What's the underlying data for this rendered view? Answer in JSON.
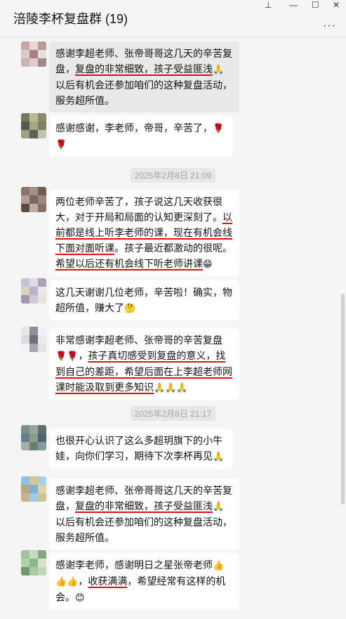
{
  "window": {
    "title": "涪陵李杯复盘群 (19)",
    "controls": {
      "pin": "⊥",
      "minimize": "—",
      "maximize": "☐",
      "close": "✕"
    },
    "more": "···"
  },
  "messages": [
    {
      "parts": [
        "感谢李超老师、张帝哥哥这几天的辛苦复盘，",
        "复盘的非常细致，孩子受益匪浅",
        "🙏",
        "以后有机会还参加咱们的这种复盘活动，服务超所值。"
      ]
    },
    {
      "parts": [
        "感谢感谢，李老师，帝哥，辛苦了，",
        "🌹",
        "🌹"
      ]
    },
    {
      "parts": [
        "两位老师辛苦了，孩子说这几天收获很大，对于开局和局面的认知更深刻了。",
        "以前都是线上听李老师的课，现在有机会线下面对面听课",
        "。孩子最近都激动的很呢。",
        "希望以后还有机会线下听老师讲课",
        "😁"
      ]
    },
    {
      "parts": [
        "这几天谢谢几位老师，辛苦啦！确实，物超所值，赚大了",
        "🤔"
      ]
    },
    {
      "parts": [
        "非常感谢李超老师、张帝哥的辛苦复盘",
        "🌹🌹",
        "，",
        "孩子真切感受到复盘的意义，找到自己的差距，希望后面在上李超老师网课时能汲取到更多知识",
        "🙏🙏🙏"
      ]
    },
    {
      "parts": [
        "也很开心认识了这么多超玥旗下的小牛娃，向你们学习，期待下次李杯再见",
        "🙏"
      ]
    },
    {
      "parts": [
        "感谢李超老师、张帝哥哥这几天的辛苦复盘，",
        "复盘的非常细致，孩子受益匪浅",
        "🙏",
        "以后有机会还参加咱们的这种复盘活动，服务超所值。"
      ]
    },
    {
      "parts": [
        "感谢李老师，感谢明日之星张帝老师",
        "👍👍👍",
        "，",
        "收获满满",
        "，希望经常有这样的机会。",
        "😊"
      ]
    }
  ],
  "timestamps": [
    "2025年2月8日 21:09",
    "2025年2月8日 21:17"
  ],
  "colors": {
    "underline": "#e01010",
    "bubble": "#ffffff",
    "selected_bubble": "#e9e9e9",
    "background": "#f5f5f5"
  }
}
